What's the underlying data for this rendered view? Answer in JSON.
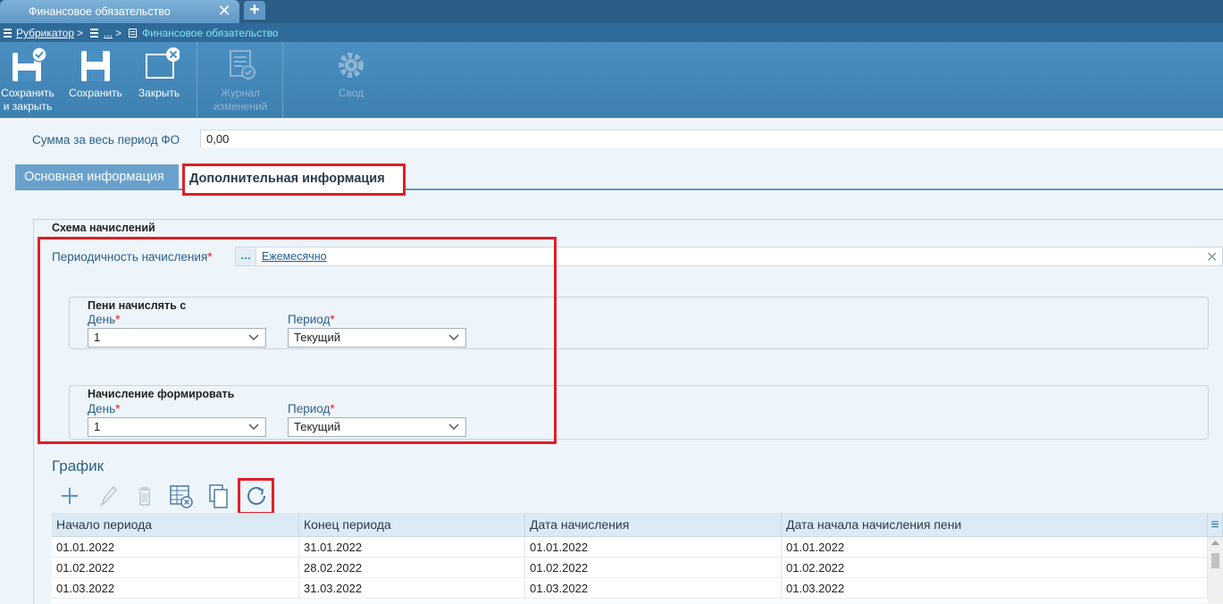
{
  "window": {
    "tab_title": "Финансовое обязательство",
    "tab_add": "+",
    "tab_close": "✕"
  },
  "breadcrumbs": {
    "root": "Рубрикатор",
    "sep": ">",
    "ellipsis": "...",
    "current": "Финансовое обязательство"
  },
  "toolbar": {
    "save_close": [
      "Сохранить",
      "и закрыть"
    ],
    "save": "Сохранить",
    "close": "Закрыть",
    "journal": [
      "Журнал",
      "изменений"
    ],
    "svod": "Свод"
  },
  "form": {
    "sum_label": "Сумма за весь период ФО",
    "sum_value": "0,00"
  },
  "tabs": {
    "main": "Основная информация",
    "extra": "Дополнительная информация"
  },
  "scheme": {
    "title": "Схема начислений",
    "periodicity_label": "Периодичность начисления",
    "required_mark": "*",
    "dots": "...",
    "periodicity_value": "Ежемесячно",
    "clear": "✕",
    "penalty": {
      "title": "Пени начислять с",
      "day_label": "День",
      "day_value": "1",
      "period_label": "Период",
      "period_value": "Текущий"
    },
    "accrual": {
      "title": "Начисление формировать",
      "day_label": "День",
      "day_value": "1",
      "period_label": "Период",
      "period_value": "Текущий"
    }
  },
  "schedule": {
    "title": "График",
    "columns": [
      "Начало периода",
      "Конец периода",
      "Дата начисления",
      "Дата начала начисления пени"
    ],
    "menu_icon": "≡",
    "rows": [
      [
        "01.01.2022",
        "31.01.2022",
        "01.01.2022",
        "01.01.2022"
      ],
      [
        "01.02.2022",
        "28.02.2022",
        "01.02.2022",
        "01.02.2022"
      ],
      [
        "01.03.2022",
        "31.03.2022",
        "01.03.2022",
        "01.03.2022"
      ]
    ]
  },
  "colors": {
    "accent": "#2c5f8a",
    "highlight": "#e01e27",
    "toolbar": "#4a8fc1"
  }
}
